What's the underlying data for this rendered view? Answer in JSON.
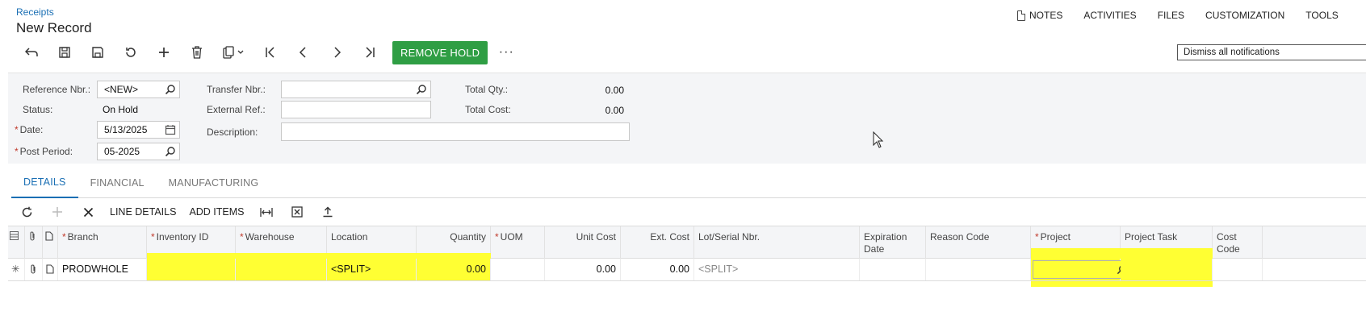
{
  "header": {
    "breadcrumb": "Receipts",
    "title": "New Record",
    "menu": [
      "NOTES",
      "ACTIVITIES",
      "FILES",
      "CUSTOMIZATION",
      "TOOLS"
    ]
  },
  "toolbar": {
    "icons": [
      "undo-icon",
      "save-close-icon",
      "save-icon",
      "cancel-icon",
      "add-icon",
      "delete-icon",
      "copy-paste-icon",
      "first-icon",
      "previous-icon",
      "next-icon",
      "last-icon"
    ],
    "remove_hold": "REMOVE HOLD",
    "more": "···",
    "dismiss": "Dismiss all notifications"
  },
  "form": {
    "reference_nbr_label": "Reference Nbr.:",
    "reference_nbr_value": "<NEW>",
    "status_label": "Status:",
    "status_value": "On Hold",
    "date_label": "Date:",
    "date_value": "5/13/2025",
    "post_period_label": "Post Period:",
    "post_period_value": "05-2025",
    "transfer_nbr_label": "Transfer Nbr.:",
    "transfer_nbr_value": "",
    "external_ref_label": "External Ref.:",
    "external_ref_value": "",
    "description_label": "Description:",
    "description_value": "",
    "total_qty_label": "Total Qty.:",
    "total_qty_value": "0.00",
    "total_cost_label": "Total Cost:",
    "total_cost_value": "0.00",
    "required_mark": "*"
  },
  "tabs": [
    "DETAILS",
    "FINANCIAL",
    "MANUFACTURING"
  ],
  "grid_toolbar": {
    "line_details": "LINE DETAILS",
    "add_items": "ADD ITEMS"
  },
  "grid": {
    "columns": {
      "branch": "Branch",
      "inventory_id": "Inventory ID",
      "warehouse": "Warehouse",
      "location": "Location",
      "quantity": "Quantity",
      "uom": "UOM",
      "unit_cost": "Unit Cost",
      "ext_cost": "Ext. Cost",
      "lot_serial": "Lot/Serial Nbr.",
      "expiration_date": "Expiration Date",
      "reason_code": "Reason Code",
      "project": "Project",
      "project_task": "Project Task",
      "cost_code": "Cost Code"
    },
    "rows": [
      {
        "branch": "PRODWHOLE",
        "inventory_id": "",
        "warehouse": "",
        "location": "<SPLIT>",
        "quantity": "0.00",
        "uom": "",
        "unit_cost": "0.00",
        "ext_cost": "0.00",
        "lot_serial": "<SPLIT>",
        "expiration_date": "",
        "reason_code": "",
        "project": "",
        "project_task": "",
        "cost_code": ""
      }
    ]
  },
  "colors": {
    "accent": "#1a6fb4",
    "remove_hold_bg": "#2f9e44",
    "highlight": "#ffff33",
    "required": "#c0392b"
  }
}
